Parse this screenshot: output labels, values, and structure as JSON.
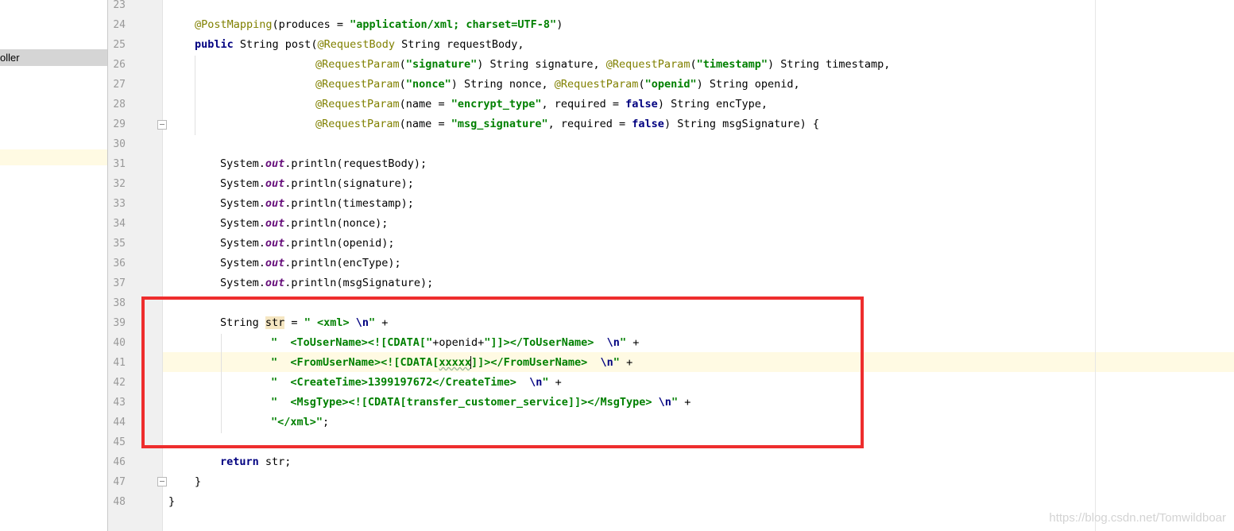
{
  "sidebar": {
    "selected_item": "oller"
  },
  "line_numbers": [
    "23",
    "24",
    "25",
    "26",
    "27",
    "28",
    "29",
    "30",
    "31",
    "32",
    "33",
    "34",
    "35",
    "36",
    "37",
    "38",
    "39",
    "40",
    "41",
    "42",
    "43",
    "44",
    "45",
    "46",
    "47",
    "48"
  ],
  "code": {
    "l24": {
      "ann": "@PostMapping",
      "p1": "(produces = ",
      "s1": "\"application/xml; charset=UTF-8\"",
      "p2": ")"
    },
    "l25": {
      "kw": "public",
      "p1": " String post(",
      "ann": "@RequestBody",
      "p2": " String requestBody,"
    },
    "l26": {
      "ann1": "@RequestParam",
      "p1": "(",
      "s1": "\"signature\"",
      "p2": ") String signature, ",
      "ann2": "@RequestParam",
      "p3": "(",
      "s2": "\"timestamp\"",
      "p4": ") String timestamp,"
    },
    "l27": {
      "ann1": "@RequestParam",
      "p1": "(",
      "s1": "\"nonce\"",
      "p2": ") String nonce, ",
      "ann2": "@RequestParam",
      "p3": "(",
      "s2": "\"openid\"",
      "p4": ") String openid,"
    },
    "l28": {
      "ann": "@RequestParam",
      "p1": "(name = ",
      "s1": "\"encrypt_type\"",
      "p2": ", required = ",
      "kw": "false",
      "p3": ") String encType,"
    },
    "l29": {
      "ann": "@RequestParam",
      "p1": "(name = ",
      "s1": "\"msg_signature\"",
      "p2": ", required = ",
      "kw": "false",
      "p3": ") String msgSignature) {"
    },
    "l31": {
      "p1": "System.",
      "f": "out",
      "p2": ".println(requestBody);"
    },
    "l32": {
      "p1": "System.",
      "f": "out",
      "p2": ".println(signature);"
    },
    "l33": {
      "p1": "System.",
      "f": "out",
      "p2": ".println(timestamp);"
    },
    "l34": {
      "p1": "System.",
      "f": "out",
      "p2": ".println(nonce);"
    },
    "l35": {
      "p1": "System.",
      "f": "out",
      "p2": ".println(openid);"
    },
    "l36": {
      "p1": "System.",
      "f": "out",
      "p2": ".println(encType);"
    },
    "l37": {
      "p1": "System.",
      "f": "out",
      "p2": ".println(msgSignature);"
    },
    "l39": {
      "p1": "String ",
      "v": "str",
      "p2": " = ",
      "s1": "\" <xml> ",
      "e": "\\n",
      "s2": "\"",
      "p3": " +"
    },
    "l40": {
      "s1": "\"  <ToUserName><![CDATA[\"",
      "p1": "+openid+",
      "s2": "\"]]></ToUserName>  ",
      "e": "\\n",
      "s3": "\"",
      "p2": " +"
    },
    "l41": {
      "s1": "\"  <FromUserName><![CDATA[",
      "s1w": "xxxxx",
      "s2": "]]></FromUserName>  ",
      "e": "\\n",
      "s3": "\"",
      "p1": " +"
    },
    "l42": {
      "s1": "\"  <CreateTime>1399197672</CreateTime>  ",
      "e": "\\n",
      "s2": "\"",
      "p1": " +"
    },
    "l43": {
      "s1": "\"  <MsgType><![CDATA[transfer_customer_service]]></MsgType> ",
      "e": "\\n",
      "s2": "\"",
      "p1": " +"
    },
    "l44": {
      "s1": "\"</xml>\"",
      "p1": ";"
    },
    "l46": {
      "kw": "return",
      "p1": " str;"
    },
    "l47": {
      "p1": "}"
    },
    "l48": {
      "p1": "}"
    }
  },
  "watermark": "https://blog.csdn.net/Tomwildboar",
  "colors": {
    "highlight_box": "#ee2d2d",
    "annotation": "#808000",
    "keyword": "#000080",
    "string": "#008000",
    "field": "#660e7a"
  }
}
